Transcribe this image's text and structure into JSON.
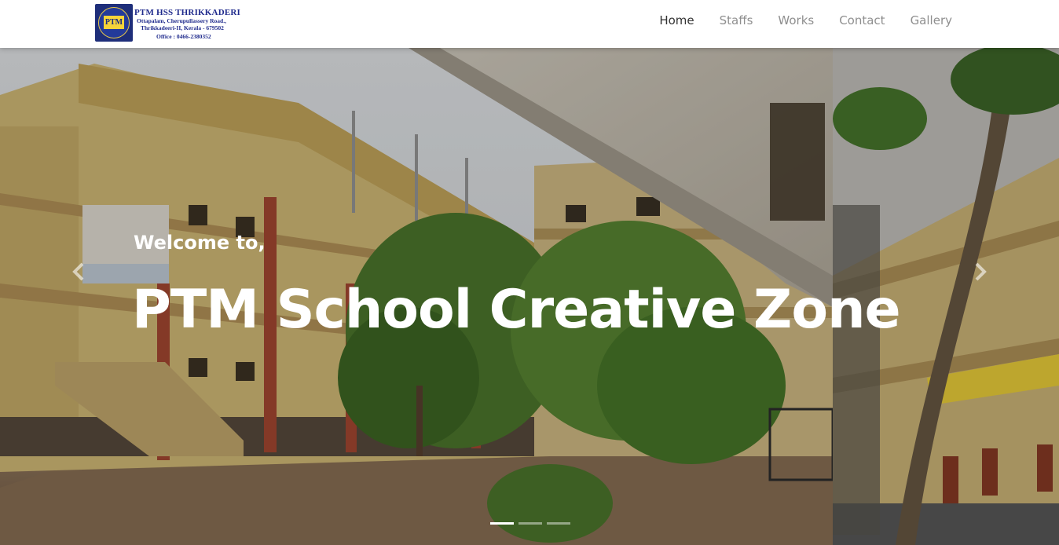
{
  "navbar": {
    "logo": {
      "emblem_text": "PTM",
      "title": "PTM HSS THRIKKADERI",
      "address_line1": "Ottapalam, Cherupullassery Road.,",
      "address_line2": "Thrikkadeeri-II, Kerala - 679502",
      "office": "Office : 0466-2380352"
    },
    "links": [
      {
        "label": "Home",
        "active": true
      },
      {
        "label": "Staffs",
        "active": false
      },
      {
        "label": "Works",
        "active": false
      },
      {
        "label": "Contact",
        "active": false
      },
      {
        "label": "Gallery",
        "active": false
      }
    ]
  },
  "hero": {
    "welcome": "Welcome to,",
    "headline": "PTM School Creative Zone",
    "prev_icon": "chevron-left-icon",
    "next_icon": "chevron-right-icon",
    "slide_count": 3,
    "active_slide": 1
  },
  "colors": {
    "nav_text": "#8f8f8f",
    "nav_active": "#333333",
    "logo_blue": "#1f2a8c",
    "hero_text": "#ffffff"
  }
}
